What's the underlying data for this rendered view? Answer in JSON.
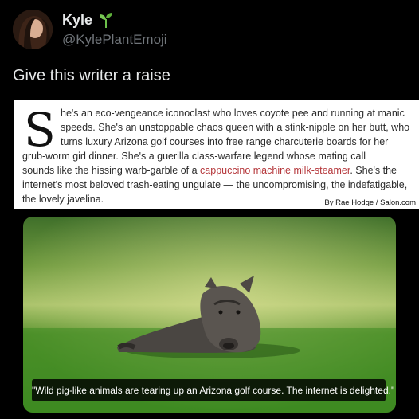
{
  "author": {
    "display_name": "Kyle",
    "handle": "@KylePlantEmoji",
    "avatar_icon": "avatar-photo",
    "name_emoji_icon": "seedling-icon"
  },
  "tweet": {
    "text": "Give this writer a raise"
  },
  "article": {
    "drop_cap": "S",
    "lines": [
      {
        "text": "he's an eco-vengeance iconoclast who loves coyote pee and running at manic"
      },
      {
        "text": "speeds. She's an unstoppable chaos queen with a stink-nipple on her butt, who"
      },
      {
        "text": "turns luxury Arizona golf courses into free range charcuterie boards for her"
      },
      {
        "text": "grub-worm girl dinner. She's a guerilla class-warfare legend whose mating call"
      },
      {
        "before": "sounds like the hissing warb-garble of a ",
        "link": "cappuccino machine milk-steamer",
        "after": ". She's the"
      },
      {
        "text": "internet's most beloved trash-eating ungulate — the uncompromising, the indefatigable,"
      },
      {
        "text": "the lovely javelina."
      }
    ],
    "byline": "By Rae Hodge / Salon.com",
    "link_color": "#b5373b"
  },
  "image": {
    "caption": "\"Wild pig-like animals are tearing up an Arizona golf course. The internet is delighted.\""
  },
  "colors": {
    "background": "#000000",
    "primary_text": "#e7e9ea",
    "secondary_text": "#71767b"
  }
}
